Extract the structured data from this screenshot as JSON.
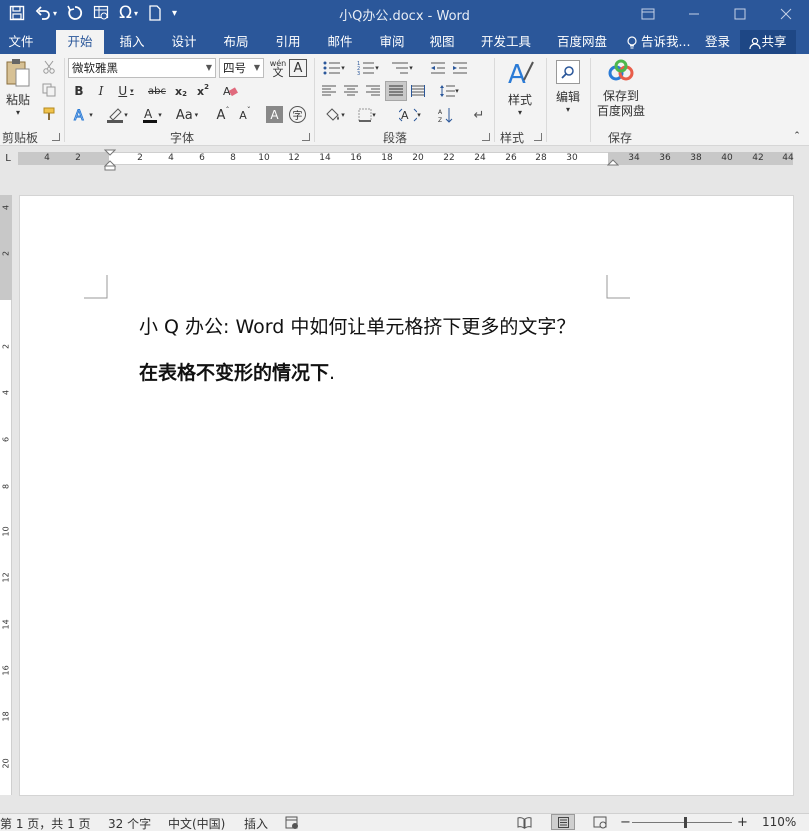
{
  "window": {
    "title": "小Q办公.docx - Word",
    "controls": [
      "ribbon-display-icon",
      "minimize-icon",
      "maximize-icon",
      "close-icon"
    ]
  },
  "qat": {
    "items": [
      "save-icon",
      "undo-icon",
      "redo-icon",
      "table-icon",
      "omega-icon",
      "new-doc-icon",
      "customize-icon"
    ]
  },
  "tabs": [
    {
      "label": "文件"
    },
    {
      "label": "开始",
      "active": true
    },
    {
      "label": "插入"
    },
    {
      "label": "设计"
    },
    {
      "label": "布局"
    },
    {
      "label": "引用"
    },
    {
      "label": "邮件"
    },
    {
      "label": "审阅"
    },
    {
      "label": "视图"
    },
    {
      "label": "开发工具"
    },
    {
      "label": "百度网盘"
    }
  ],
  "tell_me": "告诉我...",
  "login": "登录",
  "share": "共享",
  "ribbon": {
    "clipboard": {
      "paste": "粘贴",
      "label": "剪贴板"
    },
    "font": {
      "name": "微软雅黑",
      "size": "四号",
      "label": "字体",
      "phonetic_top": "wén",
      "phonetic_bottom": "文"
    },
    "paragraph": {
      "label": "段落"
    },
    "styles": {
      "button": "样式",
      "label": "样式"
    },
    "editing": {
      "button": "编辑"
    },
    "save": {
      "button_line1": "保存到",
      "button_line2": "百度网盘",
      "label": "保存"
    }
  },
  "ruler": {
    "left_numbers": [
      "4",
      "2"
    ],
    "right_numbers": [
      "2",
      "4",
      "6",
      "8",
      "10",
      "12",
      "14",
      "16",
      "18",
      "20",
      "22",
      "24",
      "26",
      "28",
      "30",
      "34",
      "36",
      "38",
      "40",
      "42",
      "44"
    ],
    "vertical_numbers": [
      "4",
      "2",
      "2",
      "4",
      "6",
      "8",
      "10",
      "12",
      "14",
      "16",
      "18",
      "20"
    ],
    "corner": "L"
  },
  "document": {
    "line1": "小 Q 办公: Word 中如何让单元格挤下更多的文字？",
    "line2": "在表格不变形的情况下",
    "line2_suffix": "."
  },
  "status": {
    "page": "第 1 页，共 1 页",
    "words": "32 个字",
    "language": "中文(中国)",
    "mode": "插入",
    "zoom": "110%",
    "zoom_level_percent": 110
  }
}
